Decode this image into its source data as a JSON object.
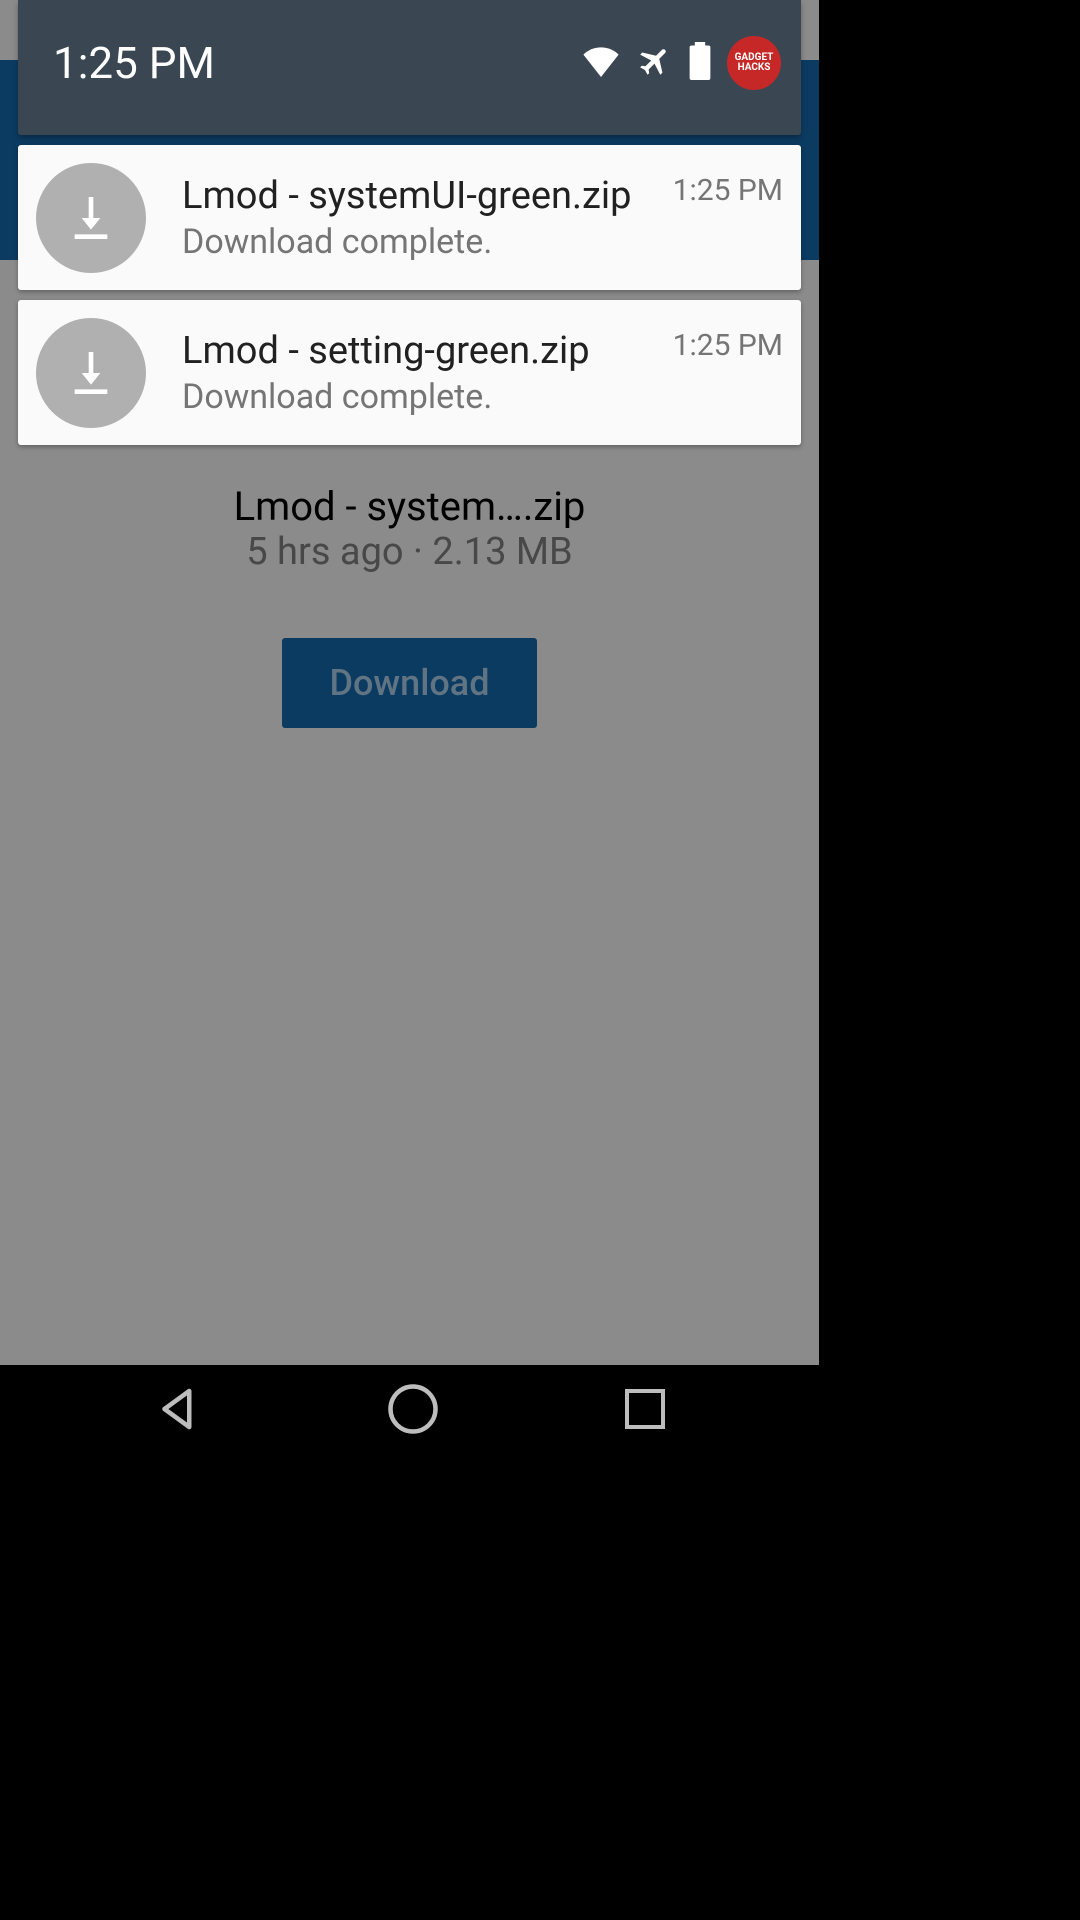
{
  "statusBar": {
    "time": "1:25 PM",
    "badge": "GADGET HACKS"
  },
  "notifications": [
    {
      "title": "Lmod - systemUI-green.zip",
      "subtitle": "Download complete.",
      "time": "1:25 PM"
    },
    {
      "title": "Lmod - setting-green.zip",
      "subtitle": "Download complete.",
      "time": "1:25 PM"
    }
  ],
  "background": {
    "fileTitle": "Lmod - system….zip",
    "fileMeta": "5 hrs ago ·  2.13 MB",
    "buttonLabel": "Download"
  }
}
